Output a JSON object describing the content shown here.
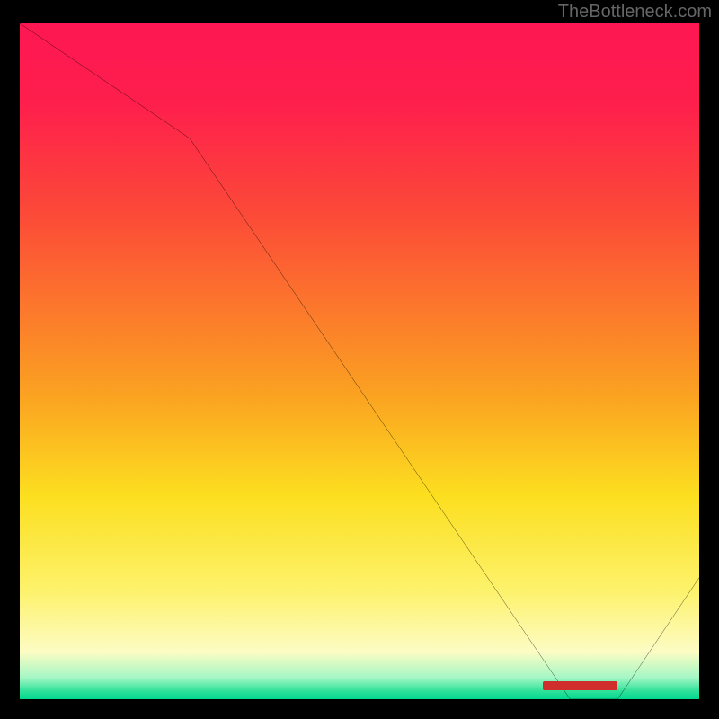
{
  "attribution": "TheBottleneck.com",
  "chart_data": {
    "type": "line",
    "title": "",
    "xlabel": "",
    "ylabel": "",
    "x": [
      0,
      25,
      81,
      88,
      100
    ],
    "values": [
      100,
      83,
      0,
      0,
      18
    ],
    "xlim": [
      0,
      100
    ],
    "ylim": [
      0,
      100
    ],
    "marker": {
      "x_start": 77,
      "x_end": 88,
      "y": 2
    },
    "background_gradient": {
      "direction": "vertical",
      "stops": [
        {
          "pos": 0,
          "color": "#fe1753"
        },
        {
          "pos": 0.28,
          "color": "#fc4938"
        },
        {
          "pos": 0.55,
          "color": "#fba221"
        },
        {
          "pos": 0.7,
          "color": "#fcdf1f"
        },
        {
          "pos": 0.93,
          "color": "#fdfcc4"
        },
        {
          "pos": 1.0,
          "color": "#00d88f"
        }
      ]
    }
  }
}
